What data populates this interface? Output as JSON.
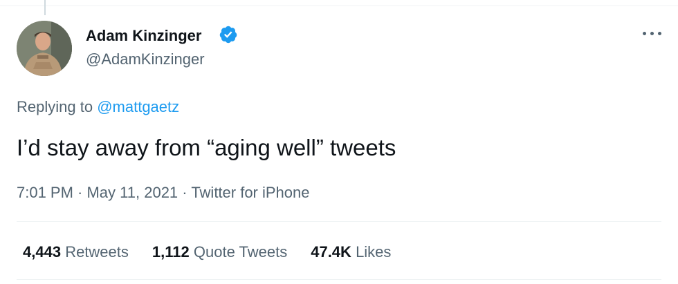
{
  "tweet": {
    "author": {
      "display_name": "Adam Kinzinger",
      "handle": "@AdamKinzinger",
      "verified": true,
      "verified_color": "#1d9bf0"
    },
    "reply_prefix": "Replying to",
    "reply_to": "@mattgaetz",
    "text": "I’d stay away from “aging well” tweets",
    "meta": "7:01 PM · May 11, 2021 · Twitter for iPhone",
    "stats": [
      {
        "value": "4,443",
        "label": "Retweets"
      },
      {
        "value": "1,112",
        "label": "Quote Tweets"
      },
      {
        "value": "47.4K",
        "label": "Likes"
      }
    ]
  },
  "colors": {
    "text_primary": "#0f1419",
    "text_secondary": "#536471",
    "link": "#1d9bf0",
    "divider": "#eff3f4"
  }
}
